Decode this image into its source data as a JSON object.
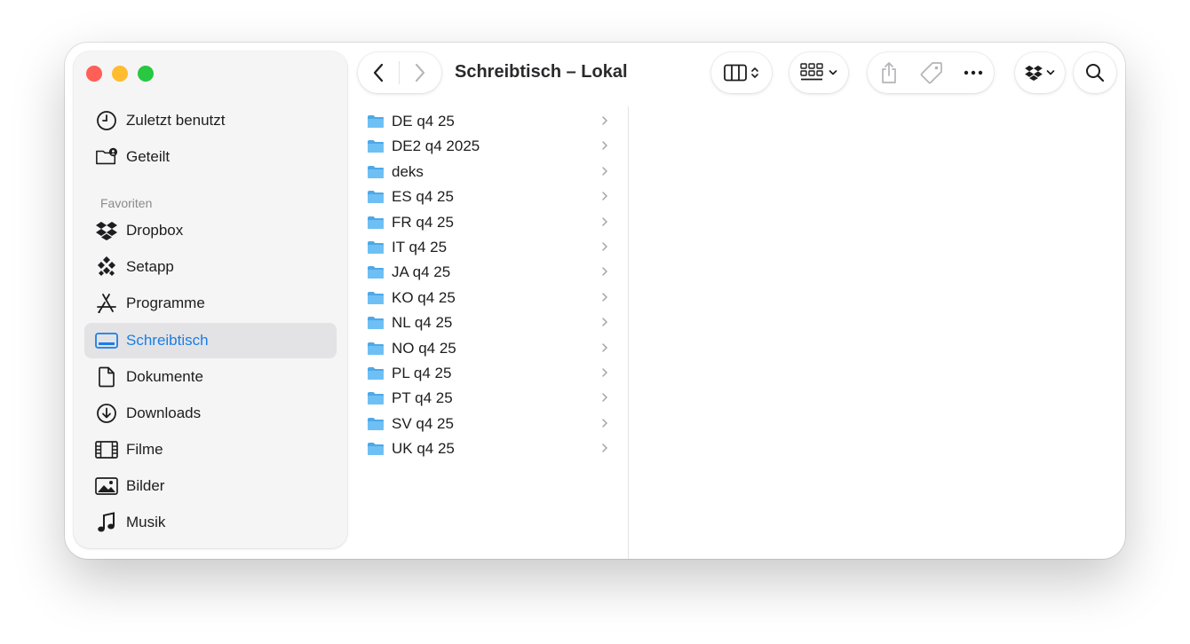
{
  "window": {
    "title": "Schreibtisch – Lokal",
    "traffic_lights": {
      "close": "#ff5f57",
      "minimize": "#febc2e",
      "zoom": "#28c840"
    }
  },
  "sidebar": {
    "top_items": [
      {
        "label": "Zuletzt benutzt",
        "icon": "clock-icon"
      },
      {
        "label": "Geteilt",
        "icon": "shared-folder-icon"
      }
    ],
    "favorites_header": "Favoriten",
    "favorites": [
      {
        "label": "Dropbox",
        "icon": "dropbox-icon"
      },
      {
        "label": "Setapp",
        "icon": "setapp-icon"
      },
      {
        "label": "Programme",
        "icon": "applications-icon"
      },
      {
        "label": "Schreibtisch",
        "icon": "desktop-icon",
        "active": true
      },
      {
        "label": "Dokumente",
        "icon": "document-icon"
      },
      {
        "label": "Downloads",
        "icon": "download-icon"
      },
      {
        "label": "Filme",
        "icon": "film-icon"
      },
      {
        "label": "Bilder",
        "icon": "photo-icon"
      },
      {
        "label": "Musik",
        "icon": "music-icon"
      }
    ],
    "accent": "#1a7ee6"
  },
  "toolbar": {
    "back_icon": "chevron-left-icon",
    "forward_icon": "chevron-right-icon",
    "view_icon": "column-view-icon",
    "group_icon": "group-icon",
    "share_icon": "share-icon",
    "tag_icon": "tag-icon",
    "more_icon": "more-icon",
    "dropbox_icon": "dropbox-icon",
    "search_icon": "search-icon"
  },
  "files": [
    "DE q4 25",
    "DE2 q4 2025",
    "deks",
    "ES q4 25",
    "FR q4 25",
    "IT q4 25",
    "JA q4 25",
    "KO q4 25",
    "NL q4 25",
    "NO q4 25",
    "PL q4 25",
    "PT q4 25",
    "SV q4 25",
    "UK q4 25"
  ],
  "folder_color": "#5ab4f0"
}
